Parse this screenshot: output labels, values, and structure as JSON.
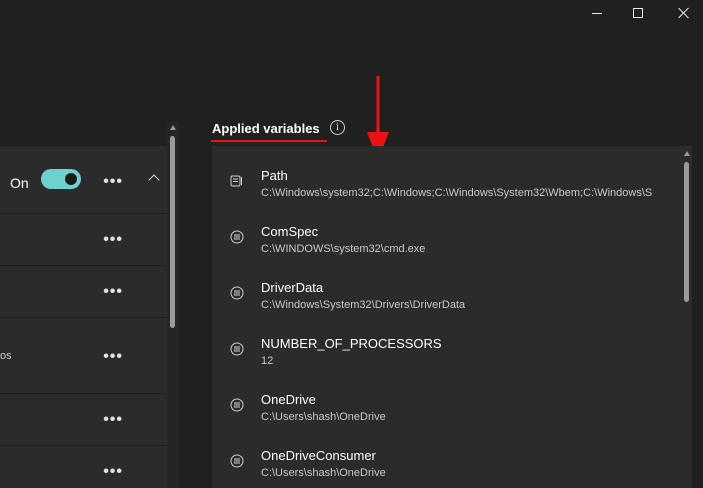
{
  "window_controls": {
    "minimize": "minimize",
    "maximize": "maximize",
    "close": "close"
  },
  "profile": {
    "status_label": "On",
    "toggle_on": true,
    "partial_row_text": "os",
    "more_label": "•••"
  },
  "applied": {
    "title": "Applied variables",
    "info_glyph": "i"
  },
  "variables": [
    {
      "name": "Path",
      "value": "C:\\Windows\\system32;C:\\Windows;C:\\Windows\\System32\\Wbem;C:\\Windows\\S",
      "icon": "path-list-icon"
    },
    {
      "name": "ComSpec",
      "value": "C:\\WINDOWS\\system32\\cmd.exe",
      "icon": "variable-icon"
    },
    {
      "name": "DriverData",
      "value": "C:\\Windows\\System32\\Drivers\\DriverData",
      "icon": "variable-icon"
    },
    {
      "name": "NUMBER_OF_PROCESSORS",
      "value": "12",
      "icon": "variable-icon"
    },
    {
      "name": "OneDrive",
      "value": "C:\\Users\\shash\\OneDrive",
      "icon": "variable-icon"
    },
    {
      "name": "OneDriveConsumer",
      "value": "C:\\Users\\shash\\OneDrive",
      "icon": "variable-icon"
    }
  ],
  "colors": {
    "accent": "#6fd0d0",
    "annotation": "#ee1111",
    "background": "#202020",
    "panel": "#2b2b2b"
  }
}
